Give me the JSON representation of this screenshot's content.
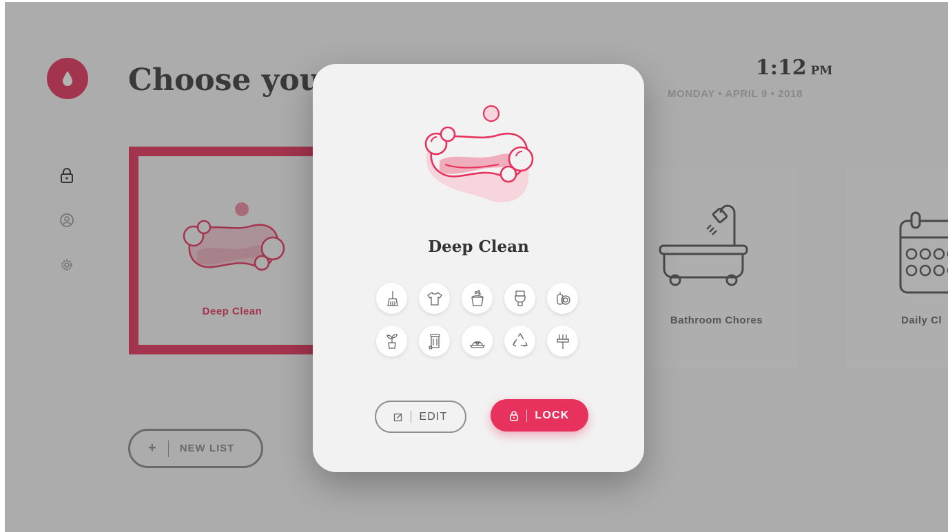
{
  "header": {
    "title": "Choose your",
    "time": "1:12",
    "ampm": "PM",
    "date": "MONDAY • APRIL 9 • 2018"
  },
  "sidebar": {
    "icons": [
      "lock-icon",
      "user-icon",
      "gear-icon"
    ]
  },
  "lists": [
    {
      "label": "Deep Clean",
      "icon": "soap-icon",
      "selected": true
    },
    {
      "label": "Bathroom Chores",
      "icon": "bathtub-icon",
      "selected": false
    },
    {
      "label": "Daily Cl",
      "icon": "calendar-icon",
      "selected": false
    }
  ],
  "new_list_label": "NEW LIST",
  "modal": {
    "title": "Deep Clean",
    "chore_icons": [
      "broom-icon",
      "shirt-icon",
      "bucket-icon",
      "toilet-icon",
      "dish-soap-icon",
      "plant-icon",
      "trash-bin-icon",
      "pet-bowl-icon",
      "recycle-icon",
      "squeegee-icon"
    ],
    "edit_label": "EDIT",
    "lock_label": "LOCK"
  },
  "colors": {
    "accent": "#e6325d",
    "accent_light": "#f6d5dc",
    "text_dark": "#333333",
    "muted": "#bbbbbb"
  }
}
